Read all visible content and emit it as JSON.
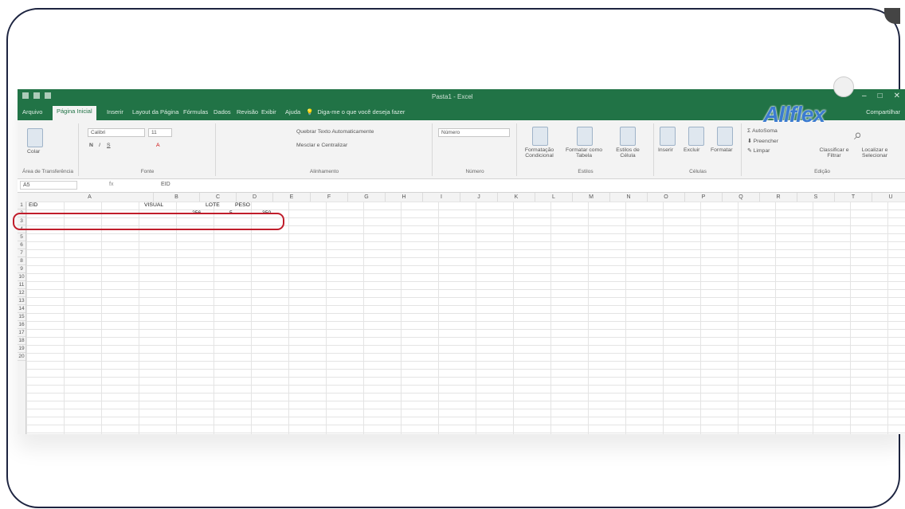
{
  "window": {
    "title": "Pasta1 - Excel"
  },
  "brand": {
    "name": "Allflex"
  },
  "tabs": [
    {
      "label": "Arquivo"
    },
    {
      "label": "Página Inicial"
    },
    {
      "label": "Inserir"
    },
    {
      "label": "Layout da Página"
    },
    {
      "label": "Fórmulas"
    },
    {
      "label": "Dados"
    },
    {
      "label": "Revisão"
    },
    {
      "label": "Exibir"
    },
    {
      "label": "Ajuda"
    }
  ],
  "tell_me": "Diga-me o que você deseja fazer",
  "share_label": "Compartilhar",
  "ribbon": {
    "clipboard": {
      "paste": "Colar",
      "label": "Área de Transferência"
    },
    "font": {
      "name": "Calibri",
      "size": "11",
      "label": "Fonte"
    },
    "alignment": {
      "wrap": "Quebrar Texto Automaticamente",
      "merge": "Mesclar e Centralizar",
      "label": "Alinhamento"
    },
    "number": {
      "format": "Número",
      "label": "Número"
    },
    "styles": {
      "conditional": "Formatação Condicional",
      "table": "Formatar como Tabela",
      "cell": "Estilos de Célula",
      "label": "Estilos"
    },
    "cells": {
      "insert": "Inserir",
      "delete": "Excluir",
      "format": "Formatar",
      "label": "Células"
    },
    "editing": {
      "autosum": "AutoSoma",
      "fill": "Preencher",
      "clear": "Limpar",
      "sort": "Classificar e Filtrar",
      "find": "Localizar e Selecionar",
      "label": "Edição"
    }
  },
  "formula_bar": {
    "cell_ref": "A5",
    "fx": "fx",
    "content": "EID"
  },
  "columns": [
    "A",
    "B",
    "C",
    "D",
    "E",
    "F",
    "G",
    "H",
    "I",
    "J",
    "K",
    "L",
    "M",
    "N",
    "O",
    "P",
    "Q",
    "R",
    "S",
    "T",
    "U"
  ],
  "rows": [
    "1",
    "2",
    "3",
    "4",
    "5",
    "6",
    "7",
    "8",
    "9",
    "10",
    "11",
    "12",
    "13",
    "14",
    "15",
    "16",
    "17",
    "18",
    "19",
    "20"
  ],
  "sheet": {
    "A1": "EID",
    "B1": "VISUAL",
    "C1": "LOTE",
    "D1": "PESO",
    "B2": "256",
    "C2": "5",
    "D2": "350"
  },
  "colors": {
    "excel_green": "#217346",
    "highlight_red": "#c01d2b"
  }
}
